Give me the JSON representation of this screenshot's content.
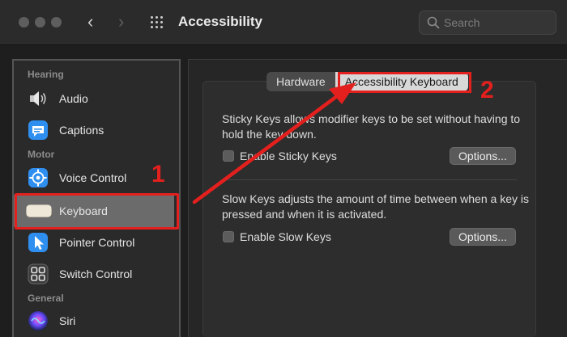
{
  "window": {
    "title": "Accessibility",
    "search_placeholder": "Search"
  },
  "sidebar": {
    "sections": [
      {
        "label": "Hearing"
      },
      {
        "label": "Motor"
      },
      {
        "label": "General"
      }
    ],
    "items": [
      {
        "label": "Audio",
        "icon": "speaker-icon"
      },
      {
        "label": "Captions",
        "icon": "captions-icon"
      },
      {
        "label": "Voice Control",
        "icon": "voice-control-icon"
      },
      {
        "label": "Keyboard",
        "icon": "keyboard-icon",
        "selected": true
      },
      {
        "label": "Pointer Control",
        "icon": "pointer-icon"
      },
      {
        "label": "Switch Control",
        "icon": "switch-control-icon"
      },
      {
        "label": "Siri",
        "icon": "siri-icon"
      }
    ]
  },
  "tabs": [
    {
      "label": "Hardware"
    },
    {
      "label": "Accessibility Keyboard",
      "active": true
    }
  ],
  "sticky": {
    "description": "Sticky Keys allows modifier keys to be set without having to hold the key down.",
    "checkbox_label": "Enable Sticky Keys",
    "button_label": "Options..."
  },
  "slow": {
    "description": "Slow Keys adjusts the amount of time between when a key is pressed and when it is activated.",
    "checkbox_label": "Enable Slow Keys",
    "button_label": "Options..."
  },
  "annotations": {
    "step1": "1",
    "step2": "2",
    "color": "#e3201d"
  }
}
